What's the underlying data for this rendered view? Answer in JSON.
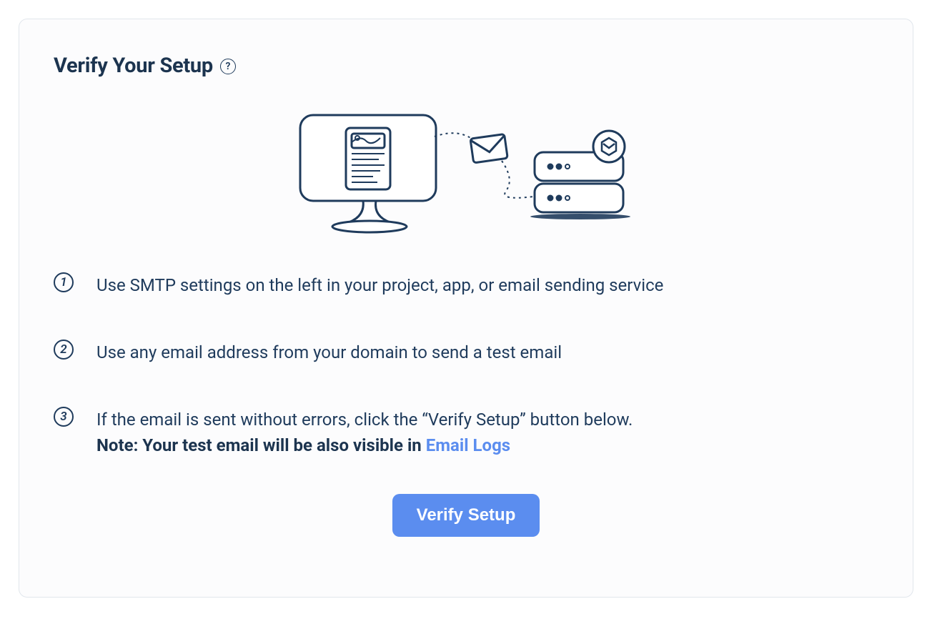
{
  "card": {
    "title": "Verify Your Setup",
    "help_tooltip": "?",
    "illustration_alt": "Computer sending email to server",
    "button_label": "Verify Setup"
  },
  "steps": [
    {
      "num": "1",
      "text": "Use SMTP settings on the left in your project, app, or email sending service"
    },
    {
      "num": "2",
      "text": "Use any email address from your domain to send a test email"
    },
    {
      "num": "3",
      "text": "If the email is sent without errors, click the “Verify Setup” button below."
    }
  ],
  "note": {
    "prefix": "Note: Your test email will be also visible in ",
    "link_text": "Email Logs"
  },
  "colors": {
    "navy": "#1f3b5c",
    "link": "#5b8def",
    "button": "#5b8def"
  },
  "icons": {
    "help": "help-icon",
    "monitor": "monitor-icon",
    "envelope": "envelope-icon",
    "server": "server-icon"
  }
}
